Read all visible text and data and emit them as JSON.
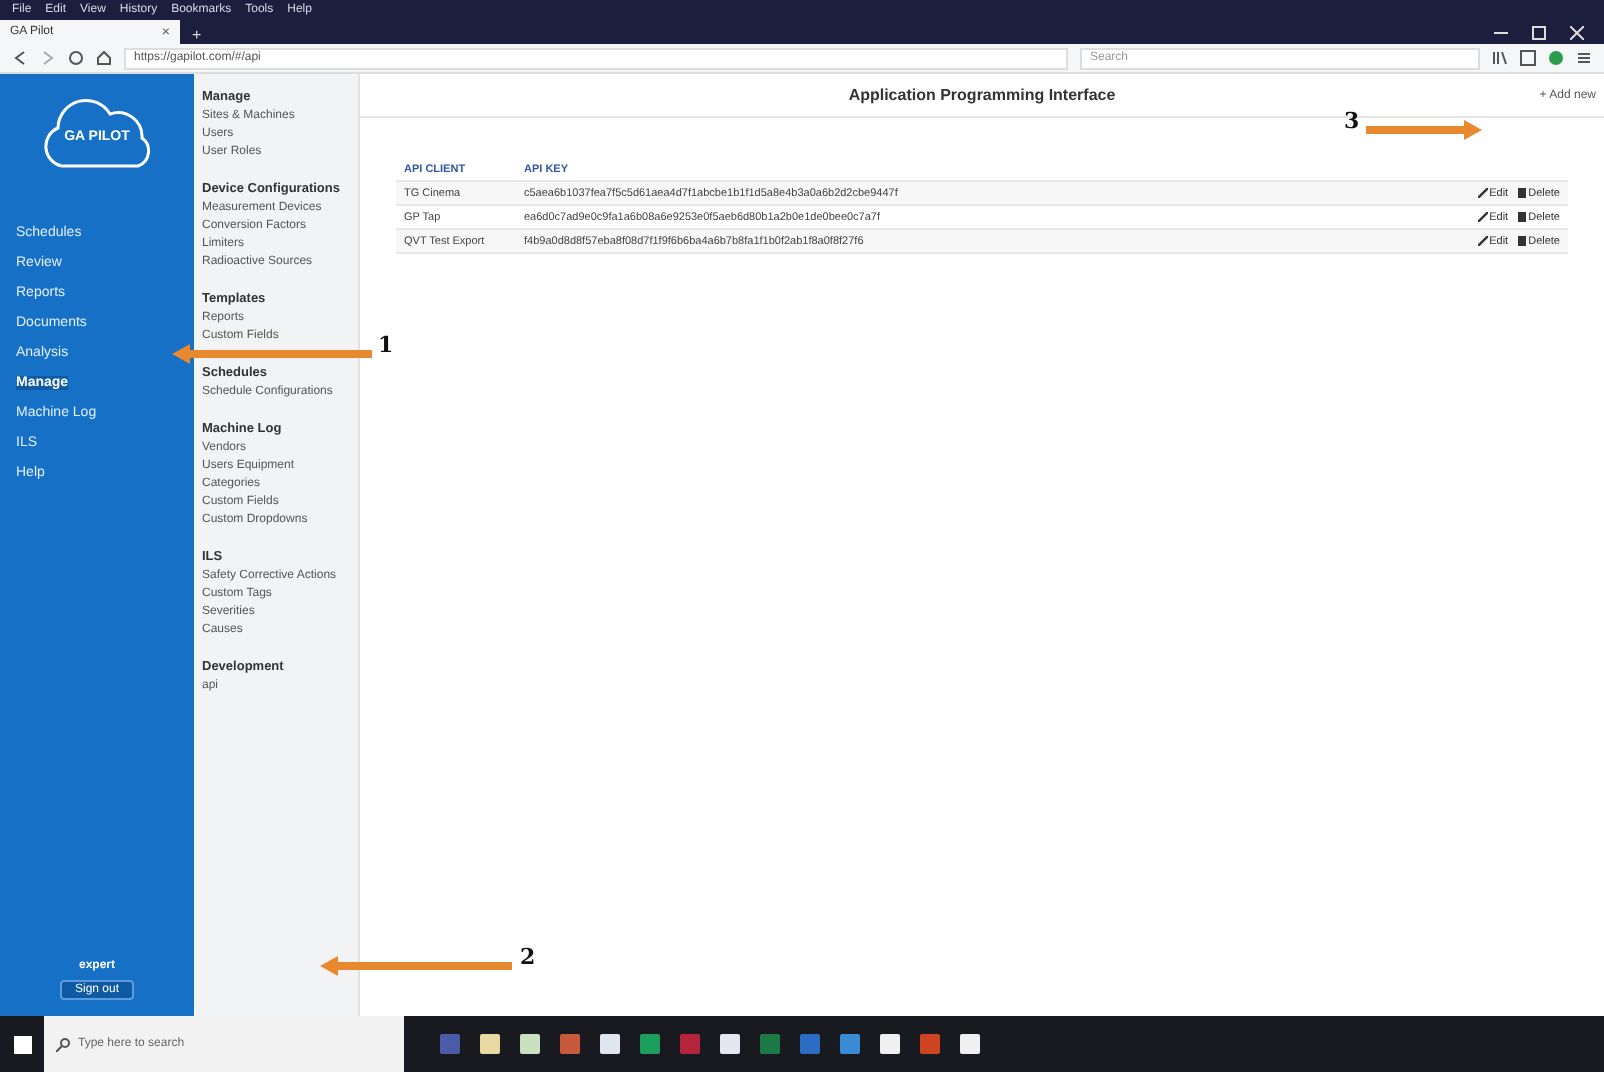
{
  "menu_bar": [
    "File",
    "Edit",
    "View",
    "History",
    "Bookmarks",
    "Tools",
    "Help"
  ],
  "browser_tab": {
    "title": "GA Pilot",
    "close": "×",
    "new_tab": "+"
  },
  "address_bar": {
    "url": "https://gapilot.com/#/api",
    "search_placeholder": "Search"
  },
  "sidebar": {
    "logo": "GA PILOT",
    "items": [
      {
        "label": "Schedules",
        "selected": false
      },
      {
        "label": "Review",
        "selected": false
      },
      {
        "label": "Reports",
        "selected": false
      },
      {
        "label": "Documents",
        "selected": false
      },
      {
        "label": "Analysis",
        "selected": false
      },
      {
        "label": "Manage",
        "selected": true
      },
      {
        "label": "Machine Log",
        "selected": false
      },
      {
        "label": "ILS",
        "selected": false
      },
      {
        "label": "Help",
        "selected": false
      }
    ],
    "user": "expert",
    "sign_out": "Sign out"
  },
  "submenu": [
    {
      "heading": "Manage",
      "items": [
        "Sites & Machines",
        "Users",
        "User Roles"
      ]
    },
    {
      "heading": "Device Configurations",
      "items": [
        "Measurement Devices",
        "Conversion Factors",
        "Limiters",
        "Radioactive Sources"
      ]
    },
    {
      "heading": "Templates",
      "items": [
        "Reports",
        "Custom Fields"
      ]
    },
    {
      "heading": "Schedules",
      "items": [
        "Schedule Configurations"
      ]
    },
    {
      "heading": "Machine Log",
      "items": [
        "Vendors",
        "Users Equipment",
        "Categories",
        "Custom Fields",
        "Custom Dropdowns"
      ]
    },
    {
      "heading": "ILS",
      "items": [
        "Safety Corrective Actions",
        "Custom Tags",
        "Severities",
        "Causes"
      ]
    },
    {
      "heading": "Development",
      "items": [
        "api"
      ]
    }
  ],
  "page": {
    "title": "Application Programming Interface",
    "add_button": "+ Add new"
  },
  "table": {
    "columns": [
      "API CLIENT",
      "API KEY"
    ],
    "rows": [
      {
        "client": "TG Cinema",
        "key": "c5aea6b1037fea7f5c5d61aea4d7f1abcbe1b1f1d5a8e4b3a0a6b2d2cbe9447f",
        "edit": "Edit",
        "delete": "Delete"
      },
      {
        "client": "GP Tap",
        "key": "ea6d0c7ad9e0c9fa1a6b08a6e9253e0f5aeb6d80b1a2b0e1de0bee0c7a7f",
        "edit": "Edit",
        "delete": "Delete"
      },
      {
        "client": "QVT Test Export",
        "key": "f4b9a0d8d8f57eba8f08d7f1f9f6b6ba4a6b7b8fa1f1b0f2ab1f8a0f8f27f6",
        "edit": "Edit",
        "delete": "Delete"
      }
    ]
  },
  "annotations": [
    {
      "number": "1"
    },
    {
      "number": "2"
    },
    {
      "number": "3"
    }
  ],
  "taskbar": {
    "search_placeholder": "Type here to search"
  }
}
